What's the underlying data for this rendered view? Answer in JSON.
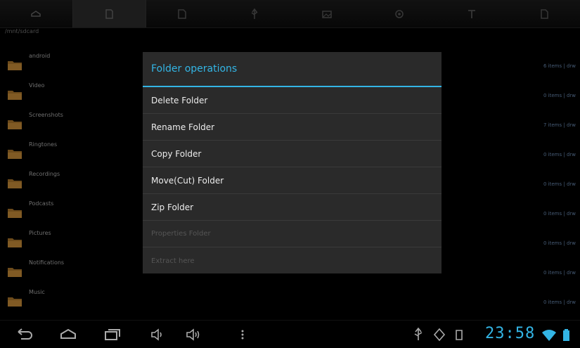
{
  "toolbar": {
    "tabs": [
      {
        "icon": "home-icon",
        "active": false
      },
      {
        "icon": "sdcard-icon",
        "active": true
      },
      {
        "icon": "document-icon",
        "active": false
      },
      {
        "icon": "usb-icon",
        "active": false
      },
      {
        "icon": "picture-icon",
        "active": false
      },
      {
        "icon": "settings-icon",
        "active": false
      },
      {
        "icon": "text-icon",
        "active": false
      },
      {
        "icon": "file-icon",
        "active": false
      }
    ]
  },
  "path": "/mnt/sdcard",
  "files": [
    {
      "name": "android",
      "meta": "6 items | drw"
    },
    {
      "name": "Video",
      "meta": "0 items | drw"
    },
    {
      "name": "Screenshots",
      "meta": "7 items | drw"
    },
    {
      "name": "Ringtones",
      "meta": "0 items | drw"
    },
    {
      "name": "Recordings",
      "meta": "0 items | drw"
    },
    {
      "name": "Podcasts",
      "meta": "0 items | drw"
    },
    {
      "name": "Pictures",
      "meta": "0 items | drw"
    },
    {
      "name": "Notifications",
      "meta": "0 items | drw"
    },
    {
      "name": "Music",
      "meta": "0 items | drw"
    }
  ],
  "dialog": {
    "title": "Folder operations",
    "options": [
      {
        "label": "Delete Folder",
        "enabled": true
      },
      {
        "label": "Rename Folder",
        "enabled": true
      },
      {
        "label": "Copy Folder",
        "enabled": true
      },
      {
        "label": "Move(Cut) Folder",
        "enabled": true
      },
      {
        "label": "Zip Folder",
        "enabled": true
      },
      {
        "label": "Properties Folder",
        "enabled": false
      },
      {
        "label": "Extract here",
        "enabled": false
      }
    ]
  },
  "statusbar": {
    "clock": "23:58",
    "accent_color": "#33b5e5"
  }
}
